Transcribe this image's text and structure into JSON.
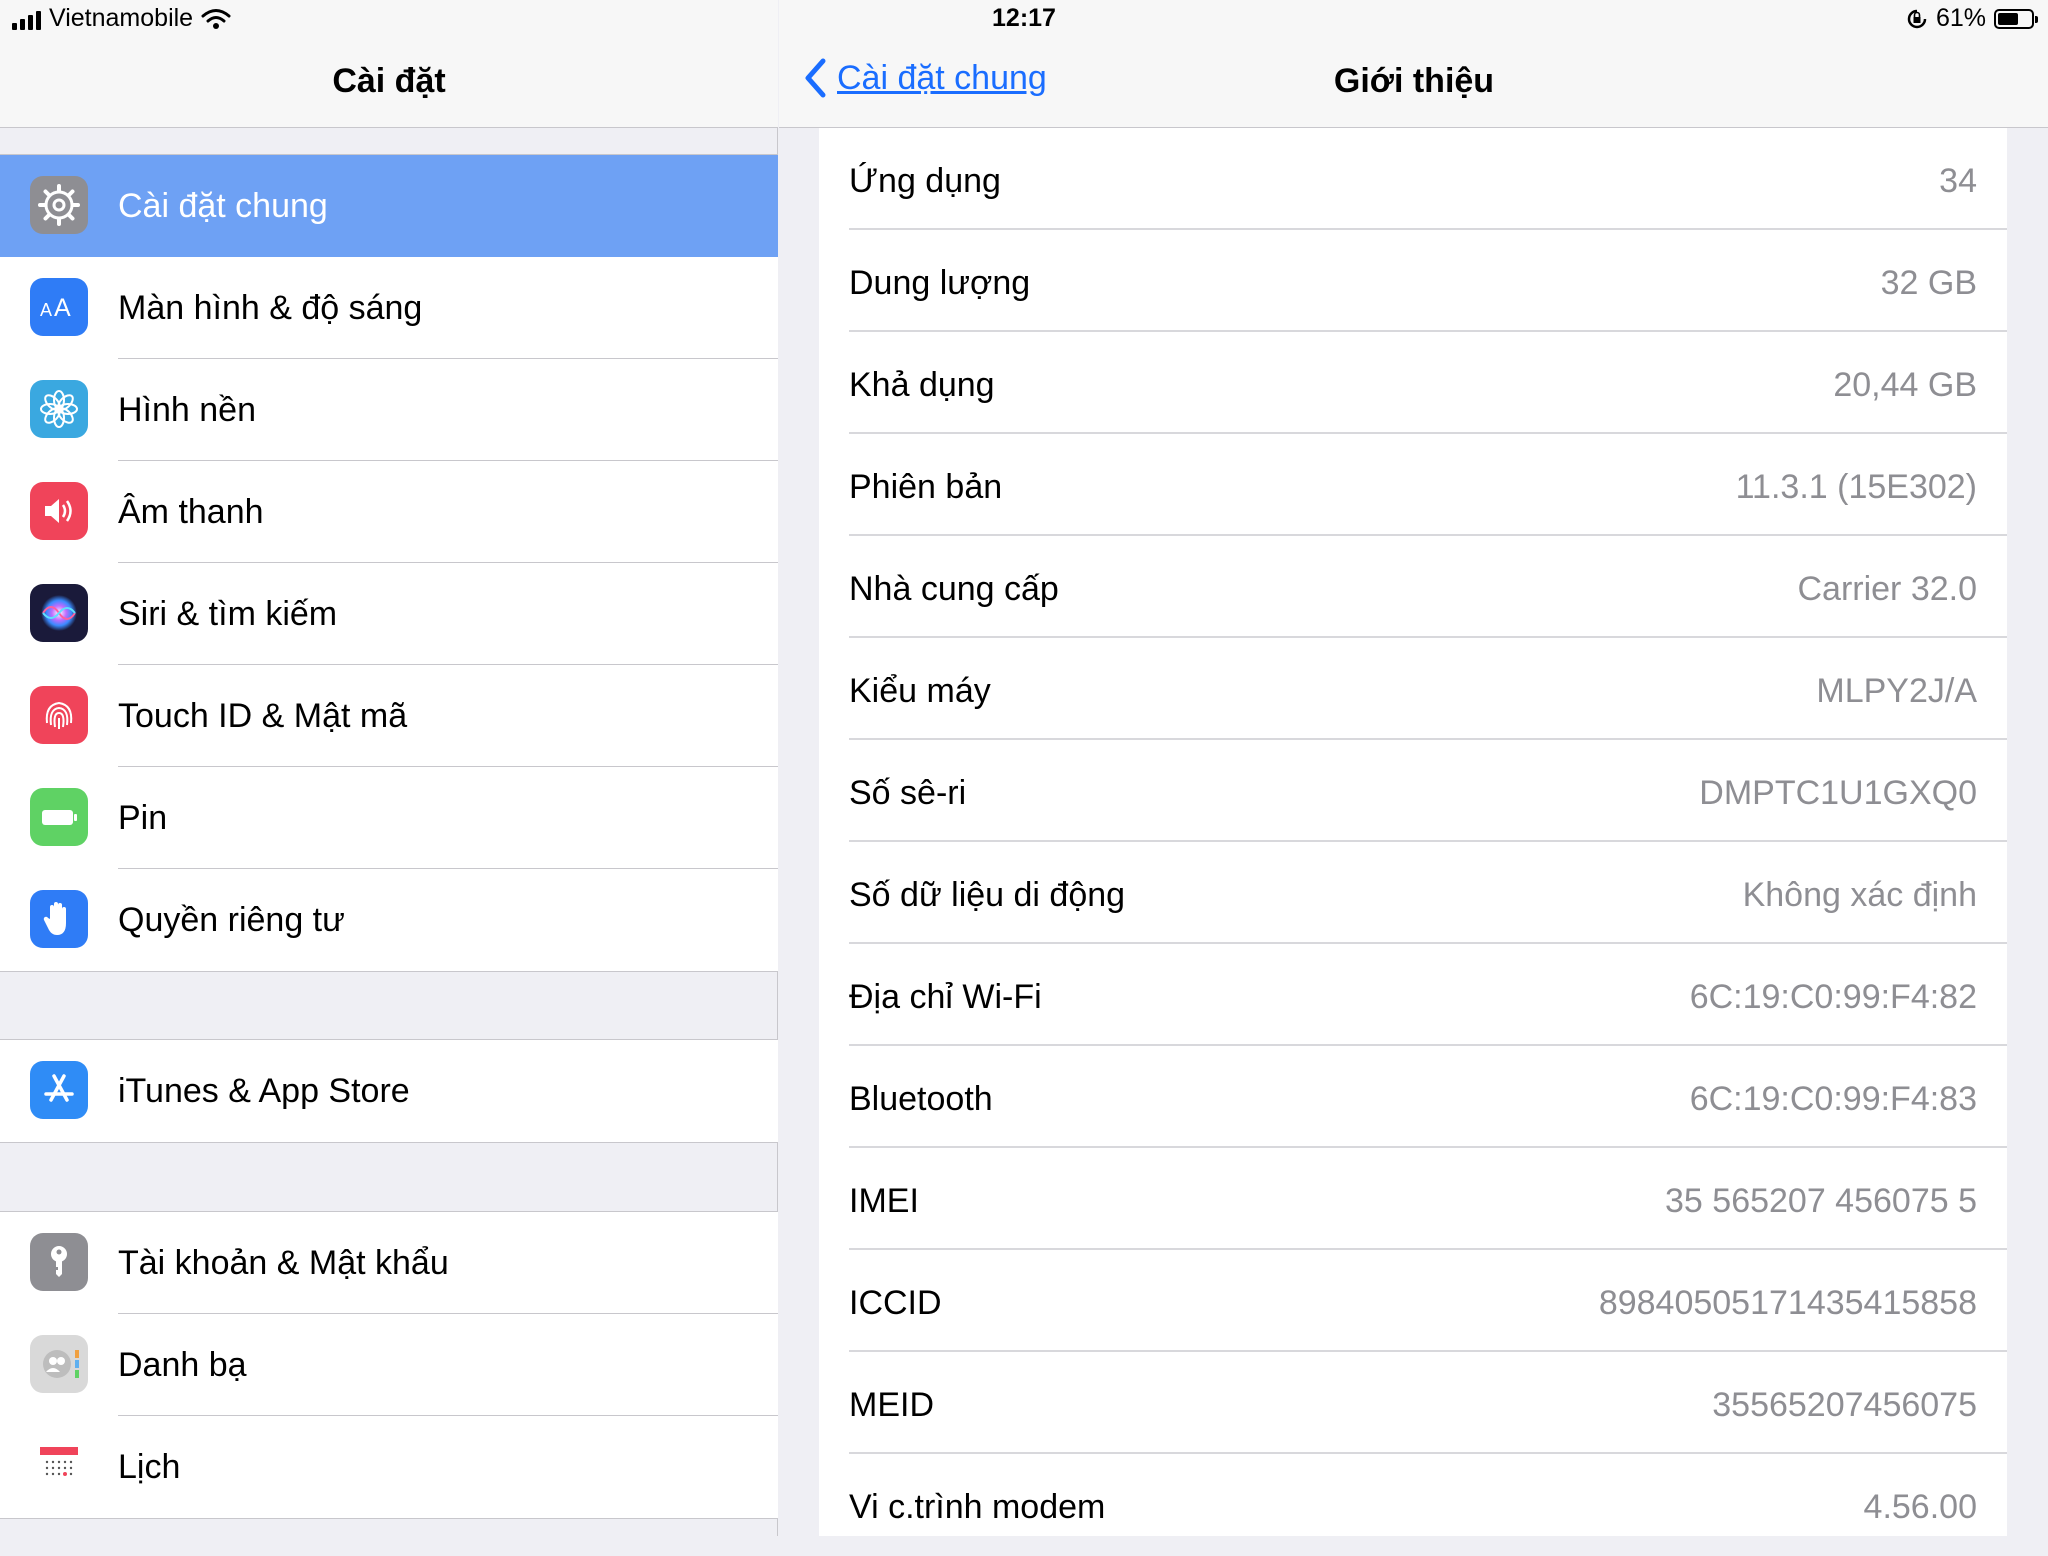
{
  "status": {
    "carrier": "Vietnamobile",
    "time": "12:17",
    "battery_text": "61%",
    "battery_level": 0.61
  },
  "master": {
    "title": "Cài đặt",
    "groups": [
      {
        "items": [
          {
            "label": "Cài đặt chung",
            "icon": "gear-icon",
            "color": "#8e8e93",
            "selected": true
          },
          {
            "label": "Màn hình & độ sáng",
            "icon": "text-size-icon",
            "color": "#2f7cf6"
          },
          {
            "label": "Hình nền",
            "icon": "flower-icon",
            "color": "#3aa8e0"
          },
          {
            "label": "Âm thanh",
            "icon": "speaker-icon",
            "color": "#f0445a"
          },
          {
            "label": "Siri & tìm kiếm",
            "icon": "siri-icon",
            "color": "#1a1a3a"
          },
          {
            "label": "Touch ID & Mật mã",
            "icon": "fingerprint-icon",
            "color": "#f0445a"
          },
          {
            "label": "Pin",
            "icon": "battery-icon",
            "color": "#5fd264"
          },
          {
            "label": "Quyền riêng tư",
            "icon": "hand-icon",
            "color": "#2f7cf6"
          }
        ]
      },
      {
        "items": [
          {
            "label": "iTunes & App Store",
            "icon": "app-store-icon",
            "color": "#2f8cf6"
          }
        ]
      },
      {
        "items": [
          {
            "label": "Tài khoản & Mật khẩu",
            "icon": "key-icon",
            "color": "#8e8e93"
          },
          {
            "label": "Danh bạ",
            "icon": "contacts-icon",
            "color": "#d9d9d9"
          },
          {
            "label": "Lịch",
            "icon": "calendar-icon",
            "color": "#ffffff"
          }
        ]
      }
    ]
  },
  "detail": {
    "back_label": "Cài đặt chung",
    "title": "Giới thiệu",
    "rows": [
      {
        "key": "Ứng dụng",
        "value": "34"
      },
      {
        "key": "Dung lượng",
        "value": "32 GB"
      },
      {
        "key": "Khả dụng",
        "value": "20,44 GB"
      },
      {
        "key": "Phiên bản",
        "value": "11.3.1 (15E302)"
      },
      {
        "key": "Nhà cung cấp",
        "value": "Carrier 32.0"
      },
      {
        "key": "Kiểu máy",
        "value": "MLPY2J/A"
      },
      {
        "key": "Số sê-ri",
        "value": "DMPTC1U1GXQ0"
      },
      {
        "key": "Số dữ liệu di động",
        "value": "Không xác định"
      },
      {
        "key": "Địa chỉ Wi-Fi",
        "value": "6C:19:C0:99:F4:82"
      },
      {
        "key": "Bluetooth",
        "value": "6C:19:C0:99:F4:83"
      },
      {
        "key": "IMEI",
        "value": "35 565207 456075 5"
      },
      {
        "key": "ICCID",
        "value": "89840505171435415858"
      },
      {
        "key": "MEID",
        "value": "35565207456075"
      },
      {
        "key": "Vi c.trình modem",
        "value": "4.56.00"
      }
    ]
  }
}
